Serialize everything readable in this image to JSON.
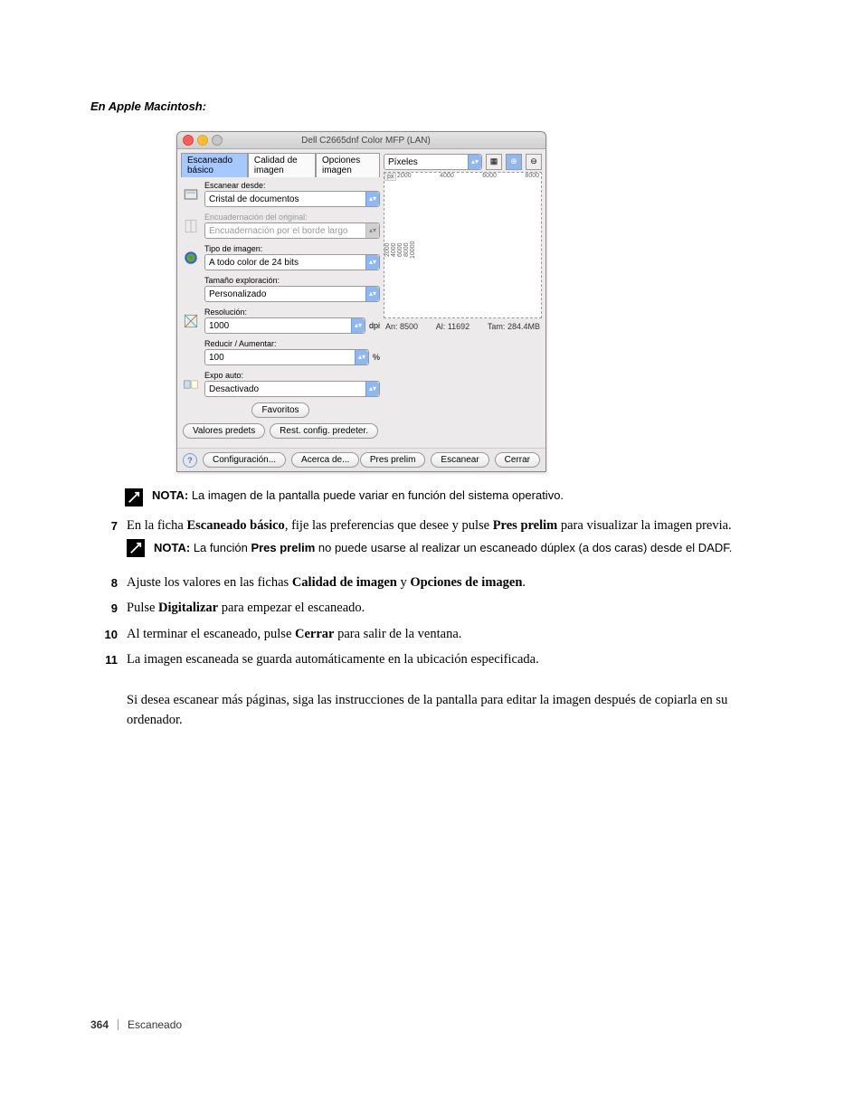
{
  "heading": "En Apple Macintosh:",
  "mac_window": {
    "title": "Dell C2665dnf Color MFP (LAN)",
    "tabs": [
      "Escaneado básico",
      "Calidad de imagen",
      "Opciones imagen"
    ],
    "fields": {
      "scan_from": {
        "label": "Escanear desde:",
        "value": "Cristal de documentos"
      },
      "binding": {
        "label": "Encuadernación del original:",
        "value": "Encuadernación por el borde largo"
      },
      "img_type": {
        "label": "Tipo de imagen:",
        "value": "A todo color de 24 bits"
      },
      "scan_size": {
        "label": "Tamaño exploración:",
        "value": "Personalizado"
      },
      "resolution": {
        "label": "Resolución:",
        "value": "1000",
        "suffix": "dpi"
      },
      "scale": {
        "label": "Reducir / Aumentar:",
        "value": "100",
        "suffix": "%"
      },
      "auto_exp": {
        "label": "Expo auto:",
        "value": "Desactivado"
      }
    },
    "buttons": {
      "favorites": "Favoritos",
      "presets": "Valores predets",
      "restore": "Rest. config. predeter.",
      "config": "Configuración...",
      "about": "Acerca de...",
      "pre_prelim": "Pres prelim",
      "scan": "Escanear",
      "close": "Cerrar"
    },
    "preview": {
      "units_select": "Píxeles",
      "px_corner": "px",
      "top_ticks": [
        "2000",
        "4000",
        "6000",
        "8000"
      ],
      "left_ticks": [
        "2000",
        "4000",
        "6000",
        "8000",
        "10000"
      ],
      "info_w_label": "An:",
      "info_w_val": "8500",
      "info_h_label": "Al:",
      "info_h_val": "11692",
      "info_s_label": "Tam:",
      "info_s_val": "284.4MB"
    }
  },
  "note1_label": "NOTA:",
  "note1_text": "La imagen de la pantalla puede variar en función del sistema operativo.",
  "note2_label": "NOTA:",
  "note2_text_a": "La función ",
  "note2_bold": "Pres prelim",
  "note2_text_b": " no puede usarse al realizar un escaneado dúplex (a dos caras) desde el DADF.",
  "steps": {
    "7": {
      "pre": "En la ficha ",
      "b1": "Escaneado básico",
      "mid": ", fije las preferencias que desee y pulse ",
      "b2": "Pres prelim",
      "post": " para visualizar la imagen previa."
    },
    "8": {
      "pre": "Ajuste los valores en las fichas ",
      "b1": "Calidad de imagen",
      "mid": " y ",
      "b2": "Opciones de imagen",
      "post": "."
    },
    "9": {
      "pre": "Pulse ",
      "b1": "Digitalizar",
      "post": " para empezar el escaneado."
    },
    "10": {
      "pre": "Al terminar el escaneado, pulse ",
      "b1": "Cerrar",
      "post": " para salir de la ventana."
    },
    "11": {
      "line1": "La imagen escaneada se guarda automáticamente en la ubicación especificada.",
      "line2": "Si desea escanear más páginas, siga las instrucciones de la pantalla para editar la imagen después de copiarla en su ordenador."
    }
  },
  "footer": {
    "page": "364",
    "section": "Escaneado"
  }
}
